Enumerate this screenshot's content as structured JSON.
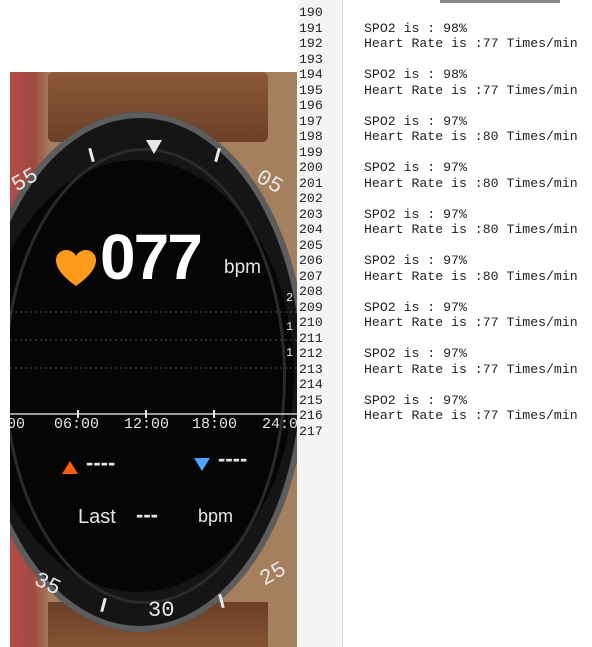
{
  "watch": {
    "heart_rate": "077",
    "unit": "bpm",
    "bezel_numbers": [
      "55",
      "05",
      "35",
      "30",
      "25"
    ],
    "time_axis": [
      ":00",
      "06:00",
      "12:00",
      "18:00",
      "24:0"
    ],
    "axis_side_numbers": [
      "2",
      "1",
      "1"
    ],
    "max_value": "----",
    "min_value": "----",
    "last_label": "Last",
    "last_value": "---",
    "last_unit": "bpm",
    "heart_color": "#ff9a1a",
    "up_color": "#ff5a14",
    "down_color": "#4aa6ff"
  },
  "log": {
    "first_line_number": 190,
    "lines": [
      "",
      "SPO2 is : 98%",
      "Heart Rate is :77 Times/min",
      "",
      "SPO2 is : 98%",
      "Heart Rate is :77 Times/min",
      "",
      "SPO2 is : 97%",
      "Heart Rate is :80 Times/min",
      "",
      "SPO2 is : 97%",
      "Heart Rate is :80 Times/min",
      "",
      "SPO2 is : 97%",
      "Heart Rate is :80 Times/min",
      "",
      "SPO2 is : 97%",
      "Heart Rate is :80 Times/min",
      "",
      "SPO2 is : 97%",
      "Heart Rate is :77 Times/min",
      "",
      "SPO2 is : 97%",
      "Heart Rate is :77 Times/min",
      "",
      "SPO2 is : 97%",
      "Heart Rate is :77 Times/min",
      ""
    ]
  }
}
